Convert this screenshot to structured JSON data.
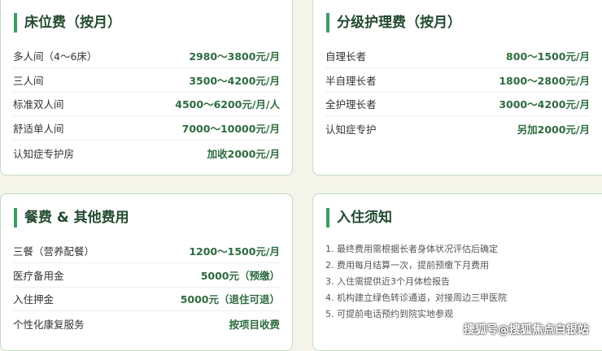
{
  "bed_fee": {
    "title": "床位费（按月）",
    "rows": [
      {
        "label": "多人间（4～6床）",
        "value": "2980～3800元/月"
      },
      {
        "label": "三人间",
        "value": "3500～4200元/月"
      },
      {
        "label": "标准双人间",
        "value": "4500～6200元/月/人"
      },
      {
        "label": "舒适单人间",
        "value": "7000～10000元/月"
      },
      {
        "label": "认知症专护房",
        "value": "加收2000元/月"
      }
    ]
  },
  "care_fee": {
    "title": "分级护理费（按月）",
    "rows": [
      {
        "label": "自理长者",
        "value": "800～1500元/月"
      },
      {
        "label": "半自理长者",
        "value": "1800～2800元/月"
      },
      {
        "label": "全护理长者",
        "value": "3000～4200元/月"
      },
      {
        "label": "认知症专护",
        "value": "另加2000元/月"
      }
    ]
  },
  "meal_fee": {
    "title": "餐费 & 其他费用",
    "rows": [
      {
        "label": "三餐（营养配餐）",
        "value": "1200～1500元/月"
      },
      {
        "label": "医疗备用金",
        "value": "5000元（预缴）"
      },
      {
        "label": "入住押金",
        "value": "5000元（退住可退）"
      },
      {
        "label": "个性化康复服务",
        "value": "按项目收费"
      }
    ]
  },
  "notice": {
    "title": "入住须知",
    "items": [
      "1. 最终费用需根据长者身体状况评估后确定",
      "2. 费用每月结算一次，提前预缴下月费用",
      "3. 入住需提供近3个月体检报告",
      "4. 机构建立绿色转诊通道，对接周边三甲医院",
      "5. 可提前电话预约到院实地参观"
    ]
  },
  "watermark": "搜狐号@搜狐焦点白银站"
}
